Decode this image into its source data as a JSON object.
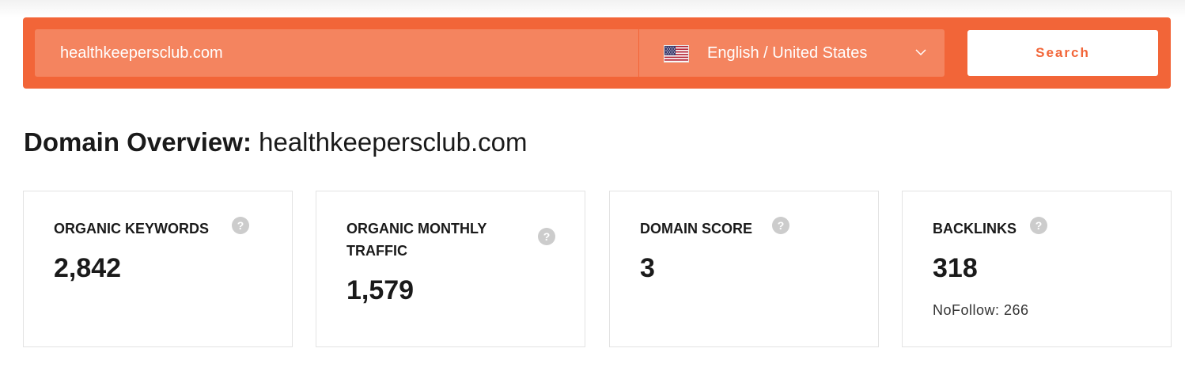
{
  "search": {
    "domain_value": "healthkeepersclub.com",
    "language": "English / United States",
    "search_label": "Search"
  },
  "overview": {
    "title_label": "Domain Overview:",
    "domain": "healthkeepersclub.com"
  },
  "cards": [
    {
      "label": "ORGANIC KEYWORDS",
      "value": "2,842",
      "help": "?"
    },
    {
      "label_line1": "ORGANIC MONTHLY",
      "label_line2": "TRAFFIC",
      "value": "1,579",
      "help": "?"
    },
    {
      "label": "DOMAIN SCORE",
      "value": "3",
      "help": "?"
    },
    {
      "label": "BACKLINKS",
      "value": "318",
      "sub": "NoFollow: 266",
      "help": "?"
    }
  ],
  "colors": {
    "brand_orange": "#f26538",
    "input_orange": "#f4845f"
  },
  "icons": {
    "flag": "us-flag-icon",
    "dropdown": "chevron-down-icon",
    "help": "question-mark-icon"
  }
}
